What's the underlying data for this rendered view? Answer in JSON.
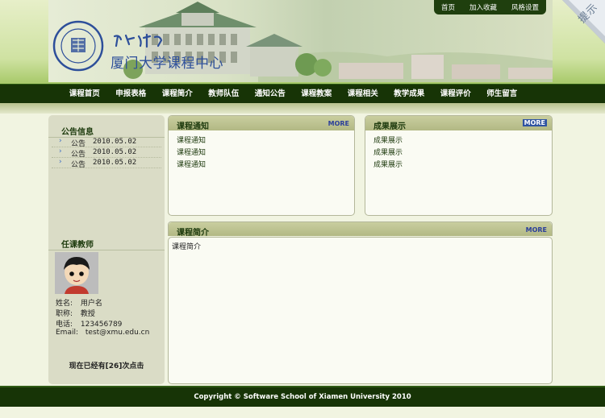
{
  "header": {
    "site_title": "厦门大学课程中心",
    "top_links": [
      "首页",
      "加入收藏",
      "风格设置"
    ],
    "tips_label": "提示"
  },
  "nav": {
    "items": [
      "课程首页",
      "申报表格",
      "课程简介",
      "教师队伍",
      "通知公告",
      "课程教案",
      "课程相关",
      "教学成果",
      "课程评价",
      "师生留言"
    ]
  },
  "sidebar": {
    "notice_title": "公告信息",
    "notices": [
      {
        "label": "公告",
        "date": "2010.05.02"
      },
      {
        "label": "公告",
        "date": "2010.05.02"
      },
      {
        "label": "公告",
        "date": "2010.05.02"
      }
    ],
    "teacher_title": "任课教师",
    "teacher": {
      "name_key": "姓名:",
      "name": "用户名",
      "title_key": "职称:",
      "title": "教授",
      "phone_key": "电话:",
      "phone": "123456789",
      "email_key": "Email:",
      "email": "test@xmu.edu.cn"
    },
    "visit_text": "现在已经有[26]次点击"
  },
  "panels": {
    "course_notice": {
      "title": "课程通知",
      "more": "MORE",
      "items": [
        "课程通知",
        "课程通知",
        "课程通知"
      ]
    },
    "results": {
      "title": "成果展示",
      "more": "MORE",
      "items": [
        "成果展示",
        "成果展示",
        "成果展示"
      ]
    },
    "intro": {
      "title": "课程简介",
      "more": "MORE",
      "content": "课程简介"
    }
  },
  "footer": {
    "copyright": "Copyright © Software School of Xiamen University 2010"
  },
  "colors": {
    "nav_bg": "#173406",
    "panel_head": "#b2b884",
    "title_blue": "#2d4f9a",
    "sidebar_bg": "#dadcc6"
  }
}
